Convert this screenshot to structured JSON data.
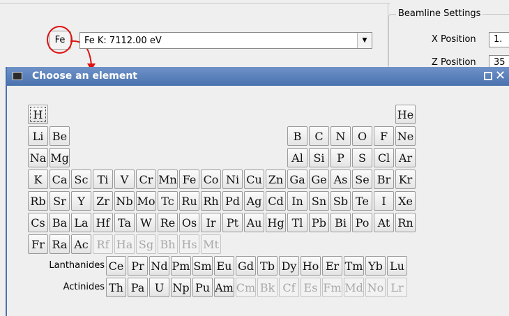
{
  "background": {
    "element_button": "Fe",
    "edge_select": "Fe K: 7112.00 eV",
    "beamline": {
      "title": "Beamline Settings",
      "x_label": "X Position",
      "x_value": "1.",
      "z_label": "Z Position",
      "z_value": "35"
    }
  },
  "dialog": {
    "title": "Choose an element"
  },
  "labels": {
    "lanthanides": "Lanthanides",
    "actinides": "Actinides"
  },
  "colors": {
    "titlebar": "#4a72ae",
    "highlight": "#e01010"
  },
  "periodic_rows": [
    [
      [
        "H",
        0,
        true
      ],
      [
        "He",
        17,
        true
      ]
    ],
    [
      [
        "Li",
        0,
        true
      ],
      [
        "Be",
        1,
        true
      ],
      [
        "B",
        12,
        true
      ],
      [
        "C",
        13,
        true
      ],
      [
        "N",
        14,
        true
      ],
      [
        "O",
        15,
        true
      ],
      [
        "F",
        16,
        true
      ],
      [
        "Ne",
        17,
        true
      ]
    ],
    [
      [
        "Na",
        0,
        true
      ],
      [
        "Mg",
        1,
        true
      ],
      [
        "Al",
        12,
        true
      ],
      [
        "Si",
        13,
        true
      ],
      [
        "P",
        14,
        true
      ],
      [
        "S",
        15,
        true
      ],
      [
        "Cl",
        16,
        true
      ],
      [
        "Ar",
        17,
        true
      ]
    ],
    [
      [
        "K",
        0,
        true
      ],
      [
        "Ca",
        1,
        true
      ],
      [
        "Sc",
        2,
        true
      ],
      [
        "Ti",
        3,
        true
      ],
      [
        "V",
        4,
        true
      ],
      [
        "Cr",
        5,
        true
      ],
      [
        "Mn",
        6,
        true
      ],
      [
        "Fe",
        7,
        true
      ],
      [
        "Co",
        8,
        true
      ],
      [
        "Ni",
        9,
        true
      ],
      [
        "Cu",
        10,
        true
      ],
      [
        "Zn",
        11,
        true
      ],
      [
        "Ga",
        12,
        true
      ],
      [
        "Ge",
        13,
        true
      ],
      [
        "As",
        14,
        true
      ],
      [
        "Se",
        15,
        true
      ],
      [
        "Br",
        16,
        true
      ],
      [
        "Kr",
        17,
        true
      ]
    ],
    [
      [
        "Rb",
        0,
        true
      ],
      [
        "Sr",
        1,
        true
      ],
      [
        "Y",
        2,
        true
      ],
      [
        "Zr",
        3,
        true
      ],
      [
        "Nb",
        4,
        true
      ],
      [
        "Mo",
        5,
        true
      ],
      [
        "Tc",
        6,
        true
      ],
      [
        "Ru",
        7,
        true
      ],
      [
        "Rh",
        8,
        true
      ],
      [
        "Pd",
        9,
        true
      ],
      [
        "Ag",
        10,
        true
      ],
      [
        "Cd",
        11,
        true
      ],
      [
        "In",
        12,
        true
      ],
      [
        "Sn",
        13,
        true
      ],
      [
        "Sb",
        14,
        true
      ],
      [
        "Te",
        15,
        true
      ],
      [
        "I",
        16,
        true
      ],
      [
        "Xe",
        17,
        true
      ]
    ],
    [
      [
        "Cs",
        0,
        true
      ],
      [
        "Ba",
        1,
        true
      ],
      [
        "La",
        2,
        true
      ],
      [
        "Hf",
        3,
        true
      ],
      [
        "Ta",
        4,
        true
      ],
      [
        "W",
        5,
        true
      ],
      [
        "Re",
        6,
        true
      ],
      [
        "Os",
        7,
        true
      ],
      [
        "Ir",
        8,
        true
      ],
      [
        "Pt",
        9,
        true
      ],
      [
        "Au",
        10,
        true
      ],
      [
        "Hg",
        11,
        true
      ],
      [
        "Tl",
        12,
        true
      ],
      [
        "Pb",
        13,
        true
      ],
      [
        "Bi",
        14,
        true
      ],
      [
        "Po",
        15,
        true
      ],
      [
        "At",
        16,
        true
      ],
      [
        "Rn",
        17,
        true
      ]
    ],
    [
      [
        "Fr",
        0,
        true
      ],
      [
        "Ra",
        1,
        true
      ],
      [
        "Ac",
        2,
        true
      ],
      [
        "Rf",
        3,
        false
      ],
      [
        "Ha",
        4,
        false
      ],
      [
        "Sg",
        5,
        false
      ],
      [
        "Bh",
        6,
        false
      ],
      [
        "Hs",
        7,
        false
      ],
      [
        "Mt",
        8,
        false
      ]
    ]
  ],
  "lanthanides": [
    [
      "Ce",
      true
    ],
    [
      "Pr",
      true
    ],
    [
      "Nd",
      true
    ],
    [
      "Pm",
      true
    ],
    [
      "Sm",
      true
    ],
    [
      "Eu",
      true
    ],
    [
      "Gd",
      true
    ],
    [
      "Tb",
      true
    ],
    [
      "Dy",
      true
    ],
    [
      "Ho",
      true
    ],
    [
      "Er",
      true
    ],
    [
      "Tm",
      true
    ],
    [
      "Yb",
      true
    ],
    [
      "Lu",
      true
    ]
  ],
  "actinides": [
    [
      "Th",
      true
    ],
    [
      "Pa",
      true
    ],
    [
      "U",
      true
    ],
    [
      "Np",
      true
    ],
    [
      "Pu",
      true
    ],
    [
      "Am",
      true
    ],
    [
      "Cm",
      false
    ],
    [
      "Bk",
      false
    ],
    [
      "Cf",
      false
    ],
    [
      "Es",
      false
    ],
    [
      "Fm",
      false
    ],
    [
      "Md",
      false
    ],
    [
      "No",
      false
    ],
    [
      "Lr",
      false
    ]
  ]
}
